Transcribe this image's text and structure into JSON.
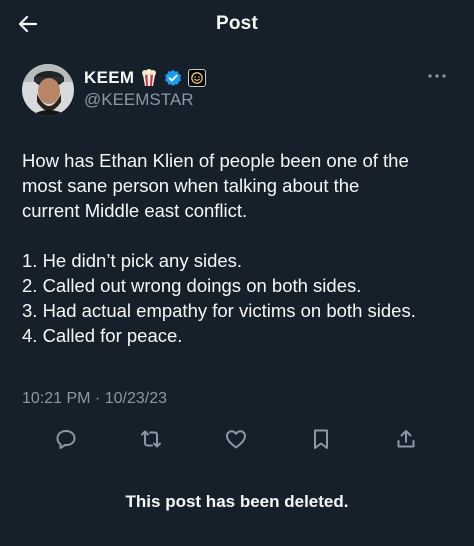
{
  "header": {
    "title": "Post",
    "back_icon": "arrow-left-icon"
  },
  "author": {
    "display_name": "KEEM",
    "handle": "@KEEMSTAR",
    "emoji_badge": "popcorn-icon",
    "verified_icon": "verified-badge-icon",
    "affiliate_icon": "affiliate-badge-icon",
    "verified_color": "#1d9bf0"
  },
  "post": {
    "lines": [
      "How has Ethan Klien of people been one of the",
      "most sane person when talking about the",
      "current Middle east conflict.",
      "1. He didn’t pick any sides.",
      "2. Called out wrong doings on both sides.",
      "3. Had actual empathy for victims on both sides.",
      "4. Called for peace."
    ],
    "timestamp": "10:21 PM · 10/23/23"
  },
  "actions": [
    "reply-icon",
    "repost-icon",
    "like-icon",
    "bookmark-icon",
    "share-icon"
  ],
  "notice": {
    "deleted": "This post has been deleted."
  },
  "colors": {
    "background": "#15202b",
    "text": "#f7f9f9",
    "secondary": "#8b98a5"
  }
}
